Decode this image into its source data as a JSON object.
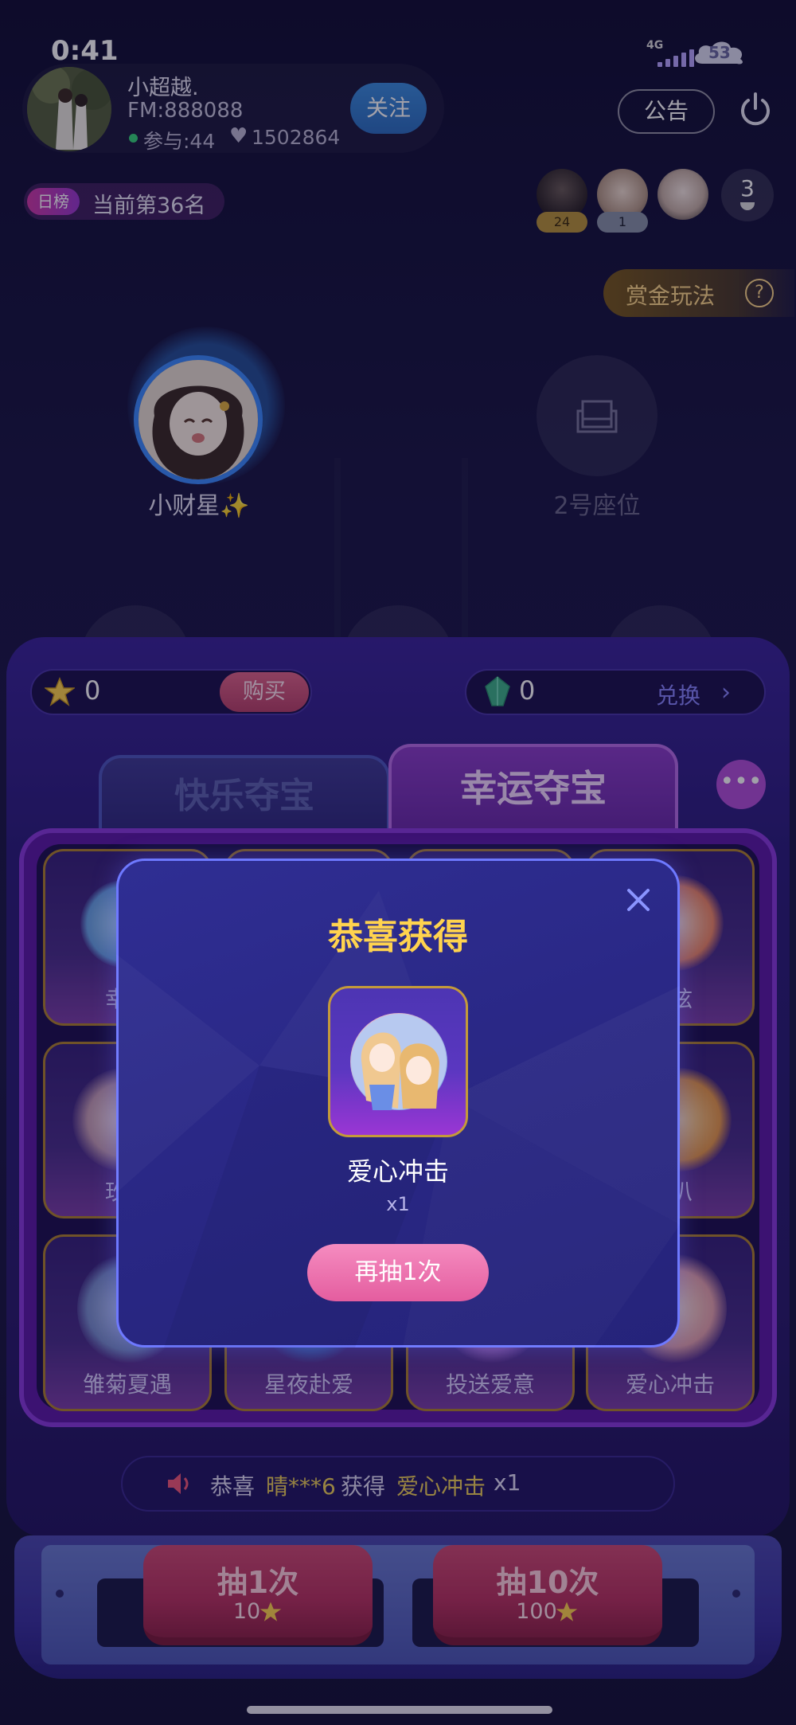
{
  "status_bar": {
    "time": "0:41",
    "network": "4G",
    "battery": "53"
  },
  "host": {
    "name": "小超越.",
    "fm": "FM:888088",
    "participants": "参与:44",
    "likes": "1502864",
    "follow_label": "关注"
  },
  "header": {
    "notice_label": "公告"
  },
  "rank": {
    "tag": "日榜",
    "text": "当前第36名"
  },
  "viewers": {
    "badges": [
      "24",
      "1"
    ],
    "count": "3"
  },
  "bounty": {
    "label": "赏金玩法",
    "help": "?"
  },
  "seats": [
    {
      "name": "小财星✨"
    },
    {
      "name": "2号座位"
    }
  ],
  "wallet": {
    "stars": "0",
    "buy_label": "购买",
    "gems": "0",
    "exchange_label": "兑换"
  },
  "tabs": [
    {
      "label": "快乐夺宝",
      "active": false
    },
    {
      "label": "幸运夺宝",
      "active": true
    }
  ],
  "prize_grid": {
    "items": [
      {
        "label": "幸运"
      },
      {
        "label": ""
      },
      {
        "label": ""
      },
      {
        "label": "心弦"
      },
      {
        "label": "玫现"
      },
      {
        "label": "喇叭"
      },
      {
        "label": "雏菊夏遇"
      },
      {
        "label": "星夜赴爱"
      },
      {
        "label": "投送爱意"
      },
      {
        "label": "爱心冲击"
      }
    ]
  },
  "ticker": {
    "prefix": "恭喜",
    "user": "晴***6",
    "verb": "获得",
    "prize": "爱心冲击",
    "qty": "x1"
  },
  "draw": {
    "one_label": "抽1次",
    "one_price": "10",
    "ten_label": "抽10次",
    "ten_price": "100"
  },
  "modal": {
    "title": "恭喜获得",
    "prize_name": "爱心冲击",
    "prize_qty": "x1",
    "again_label": "再抽1次"
  },
  "colors": {
    "accent_gold": "#ffd34e",
    "accent_pink": "#e45d9f",
    "follow_blue": "#3c8dde",
    "panel_purple": "#5d1aa6"
  }
}
